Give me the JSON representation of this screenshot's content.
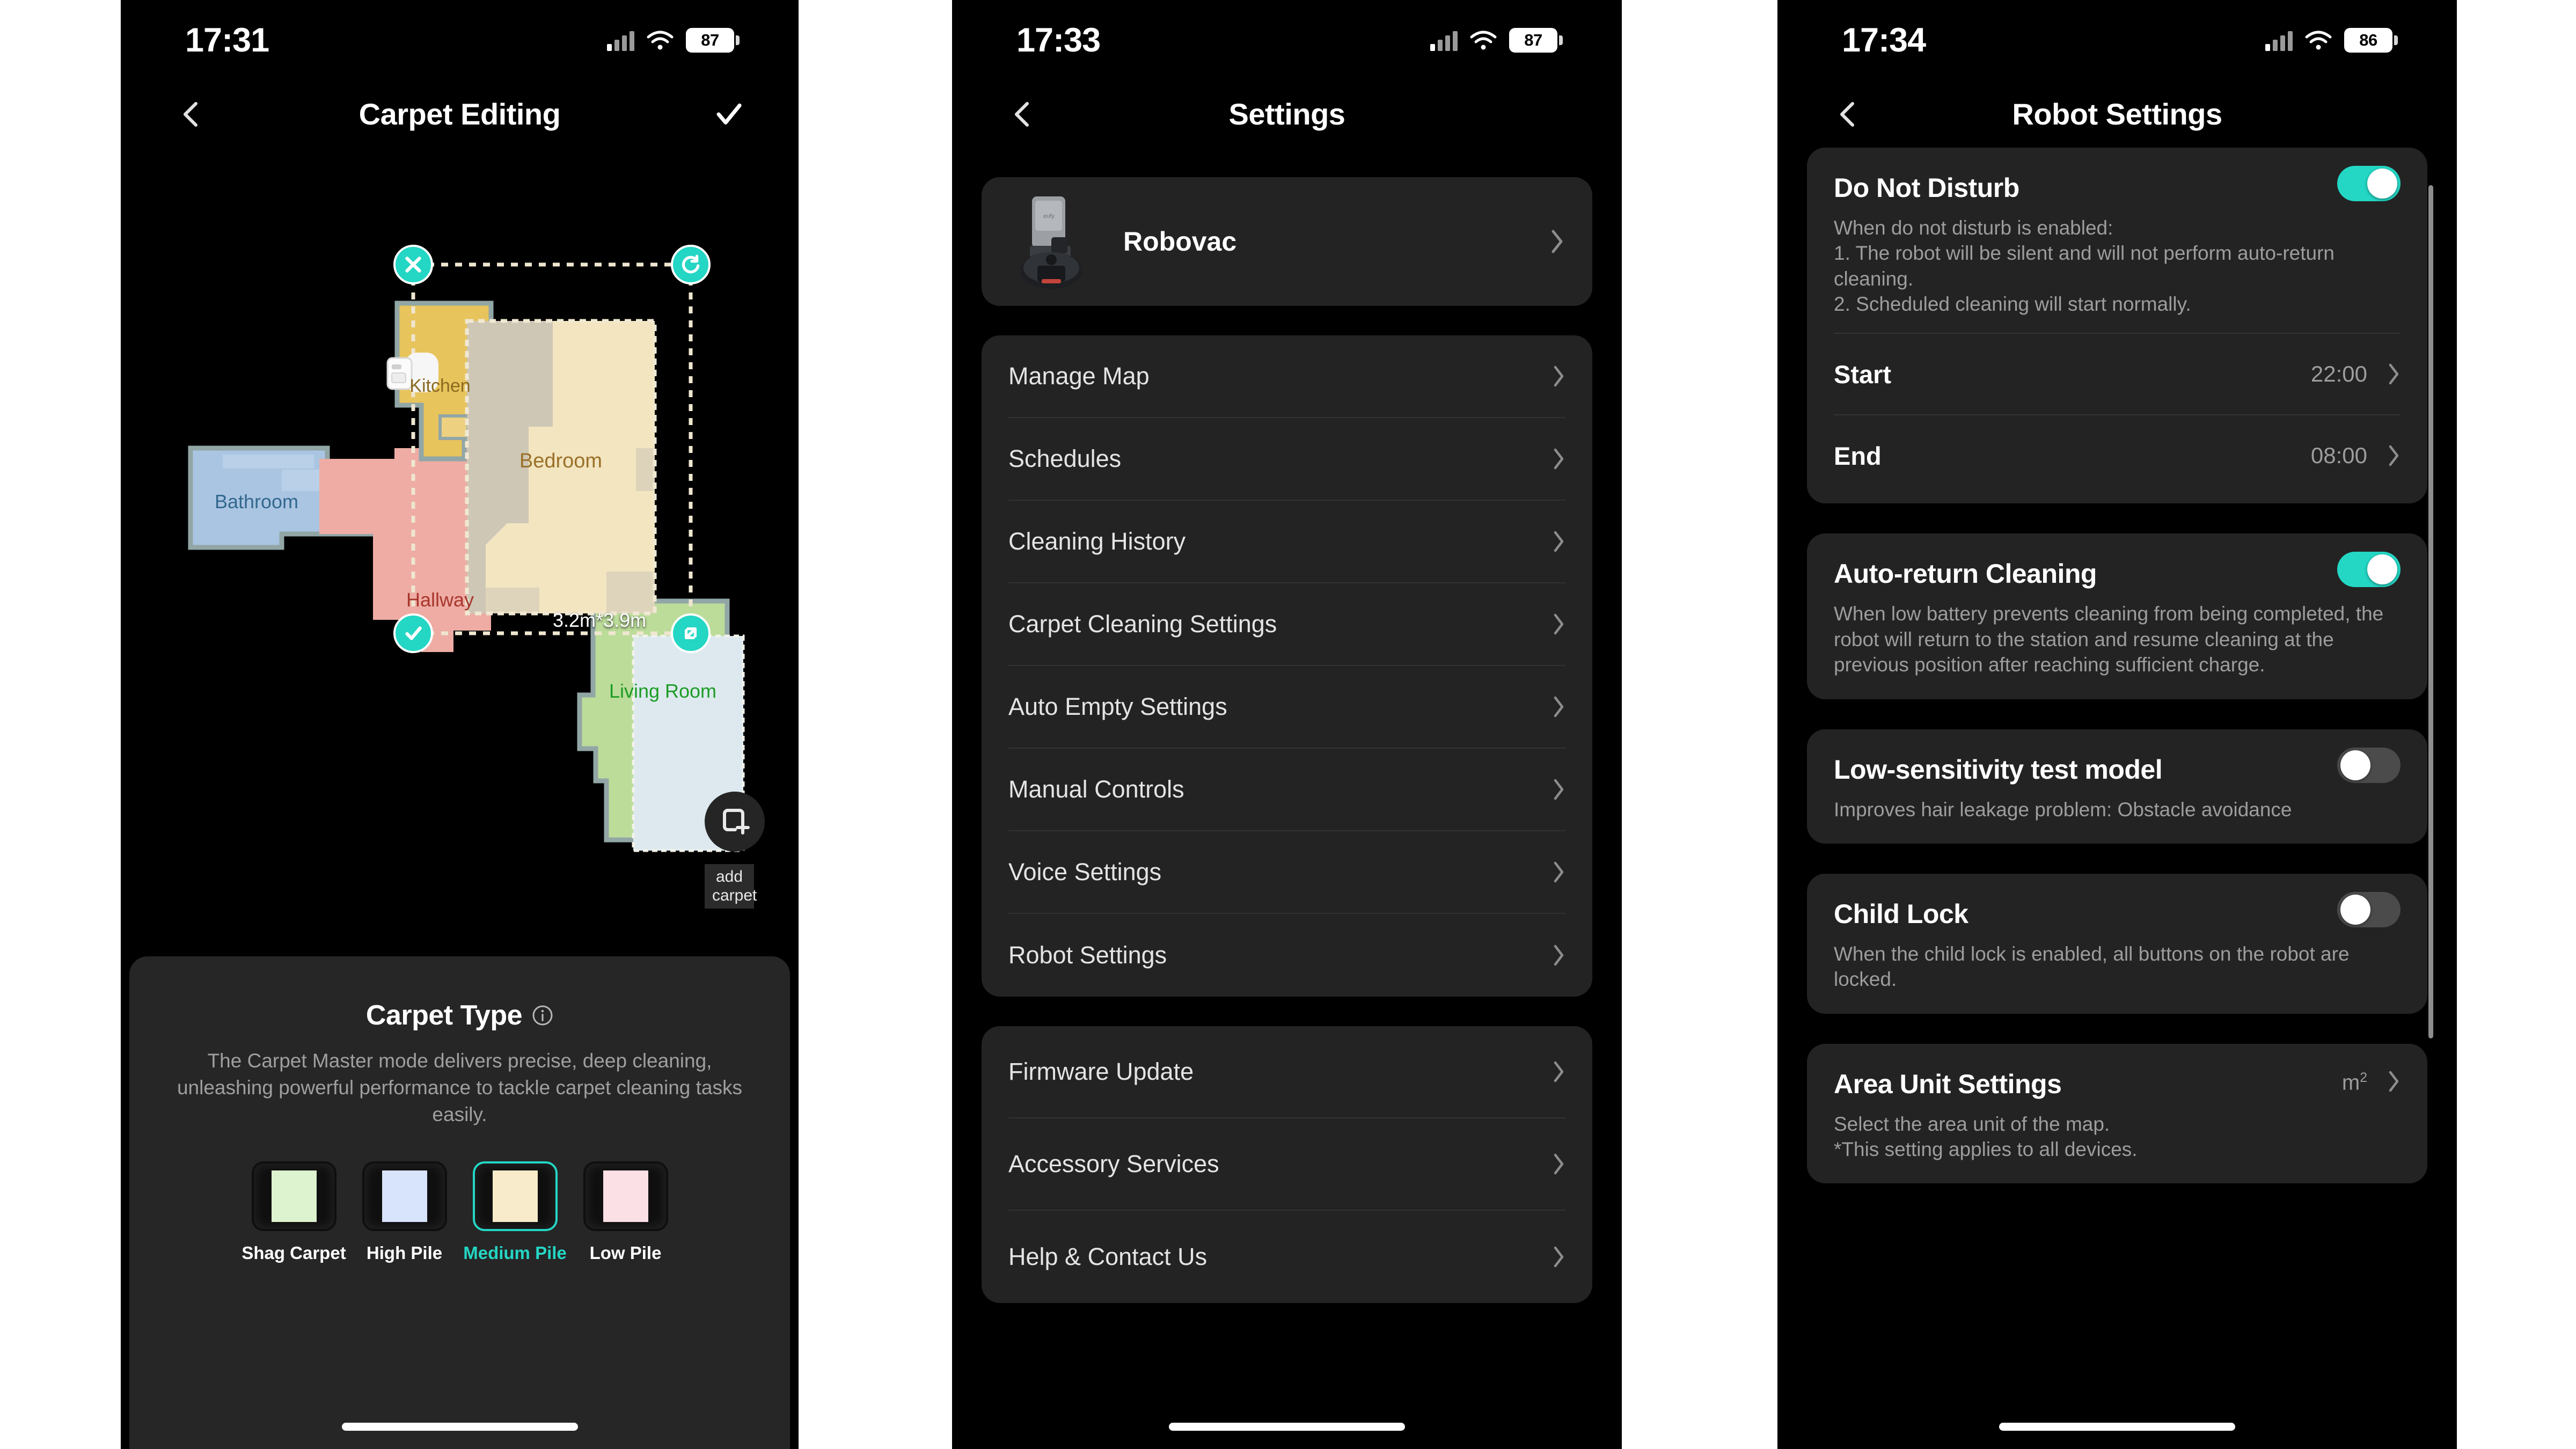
{
  "accent": "#24d6c4",
  "phone1": {
    "status": {
      "time": "17:31",
      "battery": "87"
    },
    "nav": {
      "title": "Carpet Editing",
      "back_icon": "chevron-left-icon",
      "confirm_icon": "check-icon"
    },
    "map": {
      "rooms": [
        {
          "name": "Kitchen",
          "color": "#e8c45c",
          "label_color": "#8a6a20"
        },
        {
          "name": "Bedroom",
          "color": "#f2e5c0",
          "label_color": "#9a7028"
        },
        {
          "name": "Bathroom",
          "color": "#aac5e2",
          "label_color": "#33688f"
        },
        {
          "name": "Hallway",
          "color": "#eeaca4",
          "label_color": "#a8362c"
        },
        {
          "name": "Living Room",
          "color": "#bcdc9a",
          "label_color": "#1c9c24"
        }
      ],
      "selection_size": "3.2m*3.9m",
      "handles": [
        {
          "name": "delete-handle",
          "icon": "close-icon"
        },
        {
          "name": "rotate-handle",
          "icon": "rotate-icon"
        },
        {
          "name": "confirm-handle",
          "icon": "check-icon"
        },
        {
          "name": "resize-handle",
          "icon": "resize-diagonal-icon"
        }
      ],
      "add_carpet": {
        "icon": "add-rect-icon",
        "label_line1": "add",
        "label_line2": "carpet"
      }
    },
    "sheet": {
      "title": "Carpet Type",
      "info_icon": "info-circle-icon",
      "description": "The Carpet Master mode delivers precise, deep cleaning, unleashing powerful performance to tackle carpet cleaning tasks easily.",
      "options": [
        {
          "label": "Shag Carpet",
          "color": "#ddf2cf",
          "selected": false
        },
        {
          "label": "High Pile",
          "color": "#d7e4fb",
          "selected": false
        },
        {
          "label": "Medium Pile",
          "color": "#f8ebcb",
          "selected": true
        },
        {
          "label": "Low Pile",
          "color": "#fbe0e5",
          "selected": false
        }
      ]
    }
  },
  "phone2": {
    "status": {
      "time": "17:33",
      "battery": "87"
    },
    "nav": {
      "title": "Settings",
      "back_icon": "chevron-left-icon"
    },
    "device": {
      "name": "Robovac",
      "thumb_icon": "robovac-dock-icon",
      "chevron": "chevron-right-icon"
    },
    "menu_primary": [
      "Manage Map",
      "Schedules",
      "Cleaning History",
      "Carpet Cleaning Settings",
      "Auto Empty Settings",
      "Manual Controls",
      "Voice Settings",
      "Robot Settings"
    ],
    "menu_secondary": [
      "Firmware Update",
      "Accessory Services",
      "Help & Contact Us"
    ]
  },
  "phone3": {
    "status": {
      "time": "17:34",
      "battery": "86"
    },
    "nav": {
      "title": "Robot Settings",
      "back_icon": "chevron-left-icon"
    },
    "sections": [
      {
        "name": "do-not-disturb",
        "title": "Do Not Disturb",
        "toggle": "on",
        "description": "When do not disturb is enabled:\n1. The robot will be silent and will not perform auto-return cleaning.\n2. Scheduled cleaning will start normally.",
        "rows": [
          {
            "label": "Start",
            "value": "22:00"
          },
          {
            "label": "End",
            "value": "08:00"
          }
        ]
      },
      {
        "name": "auto-return-cleaning",
        "title": "Auto-return Cleaning",
        "toggle": "on",
        "description": "When low battery prevents cleaning from being completed, the robot will return to the station and resume cleaning at the previous position after reaching sufficient charge."
      },
      {
        "name": "low-sensitivity-test-model",
        "title": "Low-sensitivity test model",
        "toggle": "off",
        "description": "Improves hair leakage problem: Obstacle avoidance"
      },
      {
        "name": "child-lock",
        "title": "Child Lock",
        "toggle": "off",
        "description": "When the child lock is enabled, all buttons on the robot are locked."
      },
      {
        "name": "area-unit-settings",
        "title": "Area Unit Settings",
        "value": "m2",
        "description": "Select the area unit of the map.\n*This setting applies to all devices."
      }
    ]
  }
}
